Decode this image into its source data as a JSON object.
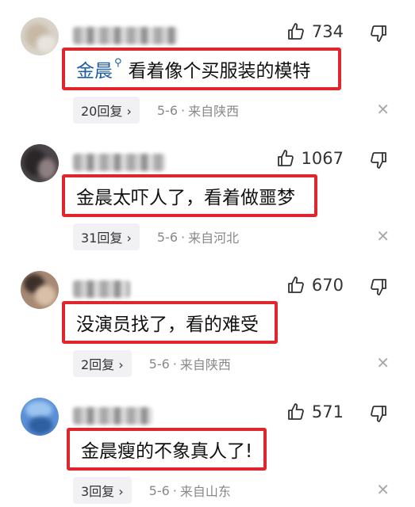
{
  "comments": [
    {
      "username": "[blurred username]",
      "likes": "734",
      "mention": "金晨",
      "text": "看着像个买服装的模特",
      "replies": "20回复 ›",
      "date": "5-6",
      "location": "来自陕西"
    },
    {
      "username": "[blurred username]",
      "likes": "1067",
      "mention": "",
      "text": "金晨太吓人了，看着做噩梦",
      "replies": "31回复 ›",
      "date": "5-6",
      "location": "来自河北"
    },
    {
      "username": "[blurred username]",
      "likes": "670",
      "mention": "",
      "text": "没演员找了，看的难受",
      "replies": "2回复 ›",
      "date": "5-6",
      "location": "来自陕西"
    },
    {
      "username": "[blurred username]",
      "likes": "571",
      "mention": "",
      "text": "金晨瘦的不象真人了!",
      "replies": "3回复 ›",
      "date": "5-6",
      "location": "来自山东"
    }
  ],
  "icons": {
    "like": "thumbs-up-icon",
    "dislike": "thumbs-down-icon",
    "close": "close-icon",
    "mention": "search-icon"
  },
  "colors": {
    "highlight_border": "#e0262b",
    "mention": "#1f5ea8",
    "meta_text": "#888888"
  }
}
